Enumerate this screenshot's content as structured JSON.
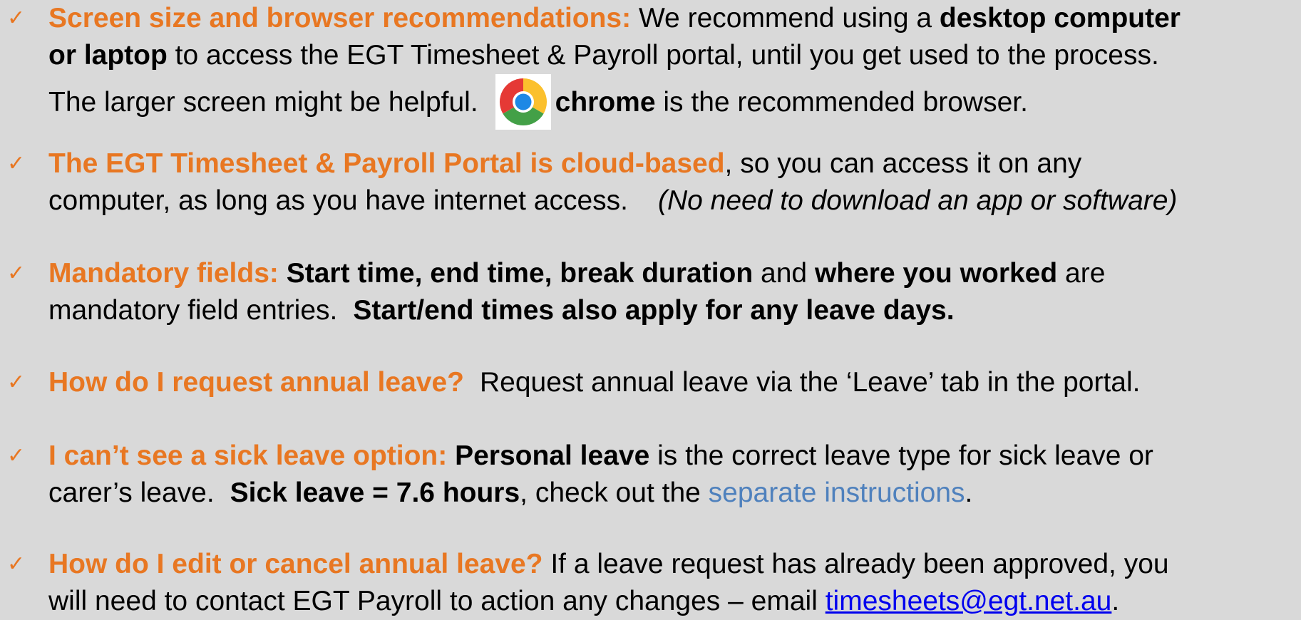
{
  "items": [
    {
      "lines": [
        {
          "heading": "Screen size and browser recommendations:",
          "t1": " We recommend using a ",
          "b1": "desktop computer"
        },
        {
          "b1": "or laptop",
          "t1": " to access the EGT Timesheet & Payroll portal, until you get used to the process."
        },
        {
          "t1": "The larger screen might be helpful.",
          "b1": "chrome",
          "t2": " is the recommended browser."
        }
      ]
    },
    {
      "lines": [
        {
          "heading": "The EGT Timesheet & Payroll Portal is cloud-based",
          "t1": ", so you can access it on any"
        },
        {
          "t1": "computer, as long as you have internet access.",
          "i1": "(No need to download an app or software)"
        }
      ]
    },
    {
      "lines": [
        {
          "heading": "Mandatory fields:",
          "b1": "Start time, end time, break duration",
          "t1": " and ",
          "b2": "where you worked",
          "t2": " are"
        },
        {
          "t1": "mandatory field entries.",
          "b1": "Start/end times also apply for any leave days."
        }
      ]
    },
    {
      "lines": [
        {
          "heading": "How do I request annual leave?",
          "t1": "Request annual leave via the ‘Leave’ tab in the portal."
        }
      ]
    },
    {
      "lines": [
        {
          "heading": "I can’t see a sick leave option:",
          "b1": "Personal leave",
          "t1": " is the correct leave type for sick leave or"
        },
        {
          "t1": "carer’s leave.",
          "b1": "Sick leave = 7.6 hours",
          "t2": ", check out the ",
          "link": "separate instructions",
          "t3": "."
        }
      ]
    },
    {
      "lines": [
        {
          "heading": "How do I edit or cancel annual leave?",
          "t1": " If a leave request has already been approved, you"
        },
        {
          "t1": "will need to contact EGT Payroll to action any changes – email ",
          "email": "timesheets@egt.net.au",
          "t2": "."
        }
      ]
    }
  ],
  "check_mark": "✓",
  "icons": {
    "browser": "chrome-logo-icon"
  },
  "colors": {
    "background": "#d9d9d9",
    "heading": "#e87722",
    "soft_link": "#4f81bd",
    "email_link": "#0000ee"
  }
}
